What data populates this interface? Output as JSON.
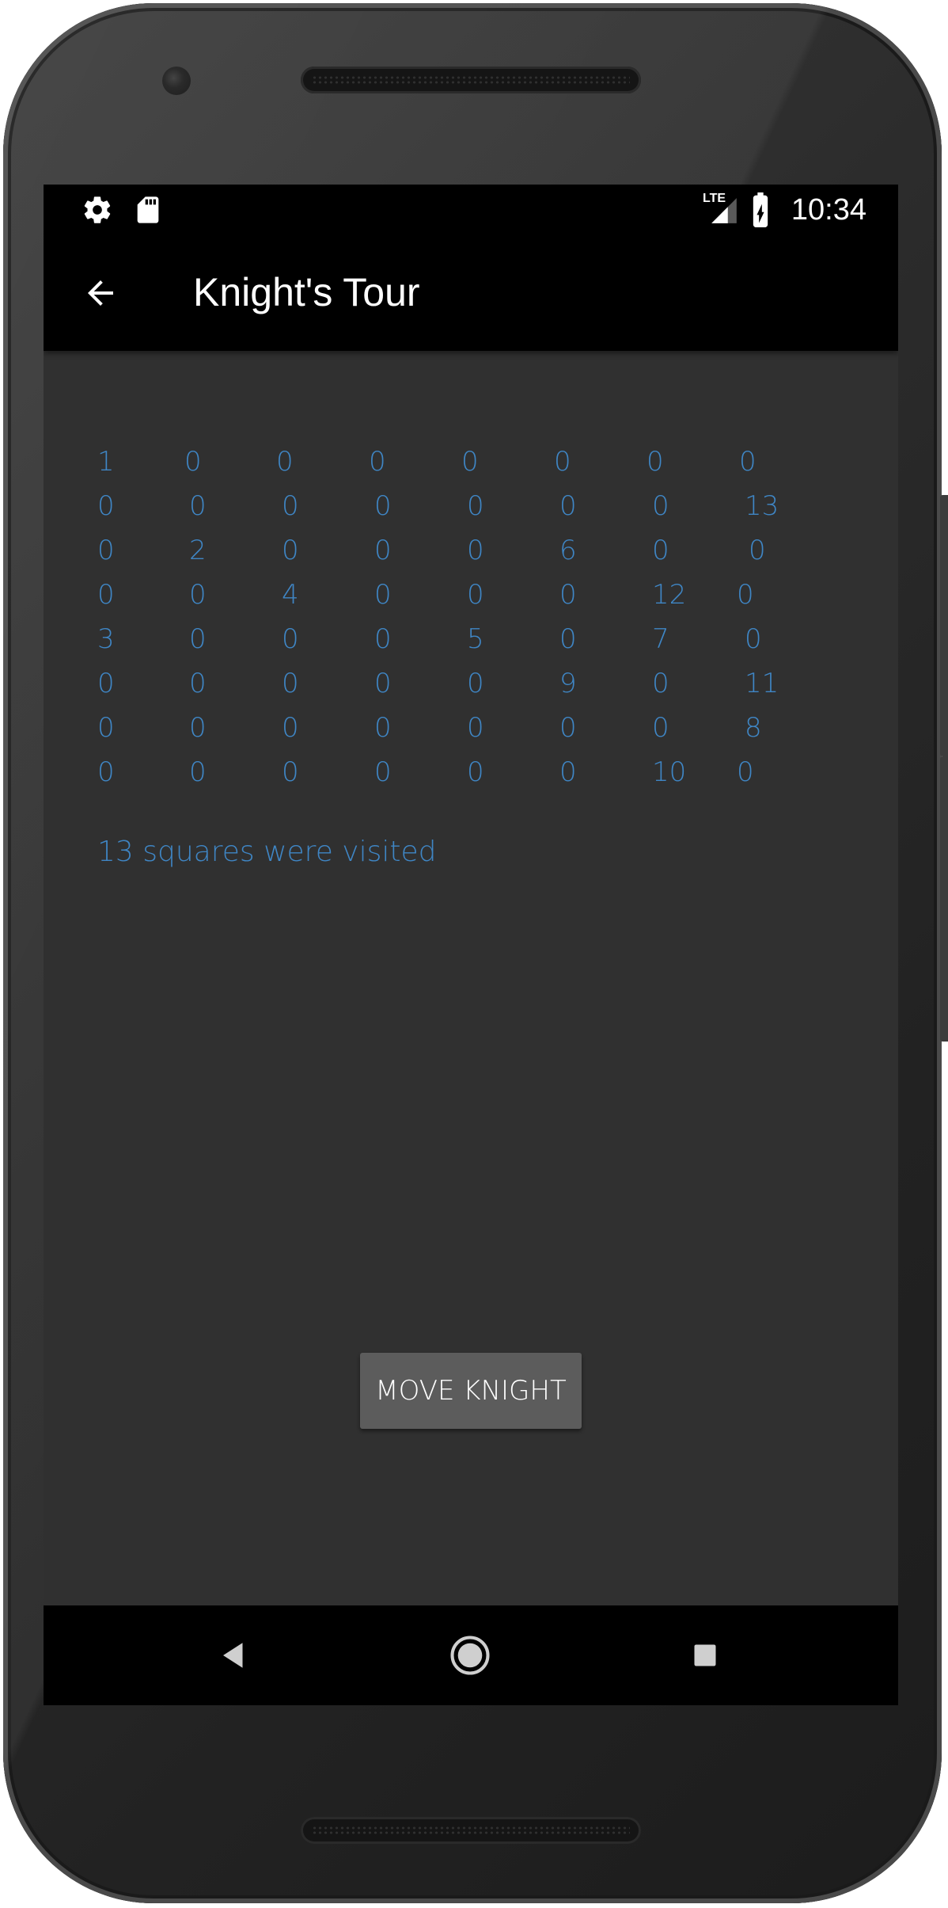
{
  "status_bar": {
    "time": "10:34",
    "network_label": "LTE",
    "left_icons": [
      "settings-icon",
      "sd-card-icon"
    ],
    "right_icons": [
      "lte-signal-icon",
      "battery-charging-icon"
    ]
  },
  "toolbar": {
    "title": "Knight's Tour",
    "back_icon": "arrow-back-icon"
  },
  "board": {
    "rows": [
      [
        "1",
        "0",
        "0",
        "0",
        "0",
        "0",
        "0",
        "0"
      ],
      [
        "0",
        "0",
        "0",
        "0",
        "0",
        "0",
        "0",
        "13"
      ],
      [
        "0",
        "2",
        "0",
        "0",
        "0",
        "6",
        "0",
        "0"
      ],
      [
        "0",
        "0",
        "4",
        "0",
        "0",
        "0",
        "12",
        "0"
      ],
      [
        "3",
        "0",
        "0",
        "0",
        "5",
        "0",
        "7",
        "0"
      ],
      [
        "0",
        "0",
        "0",
        "0",
        "0",
        "9",
        "0",
        "11"
      ],
      [
        "0",
        "0",
        "0",
        "0",
        "0",
        "0",
        "0",
        "8"
      ],
      [
        "0",
        "0",
        "0",
        "0",
        "0",
        "0",
        "10",
        "0"
      ]
    ]
  },
  "visited_text": "13 squares were visited",
  "move_button_label": "MOVE KNIGHT",
  "nav_bar": {
    "icons": [
      "nav-back-icon",
      "nav-home-icon",
      "nav-recents-icon"
    ]
  },
  "colors": {
    "accent": "#3f86c5",
    "background": "#303030",
    "bars": "#000000",
    "button": "#5c5c5c"
  }
}
